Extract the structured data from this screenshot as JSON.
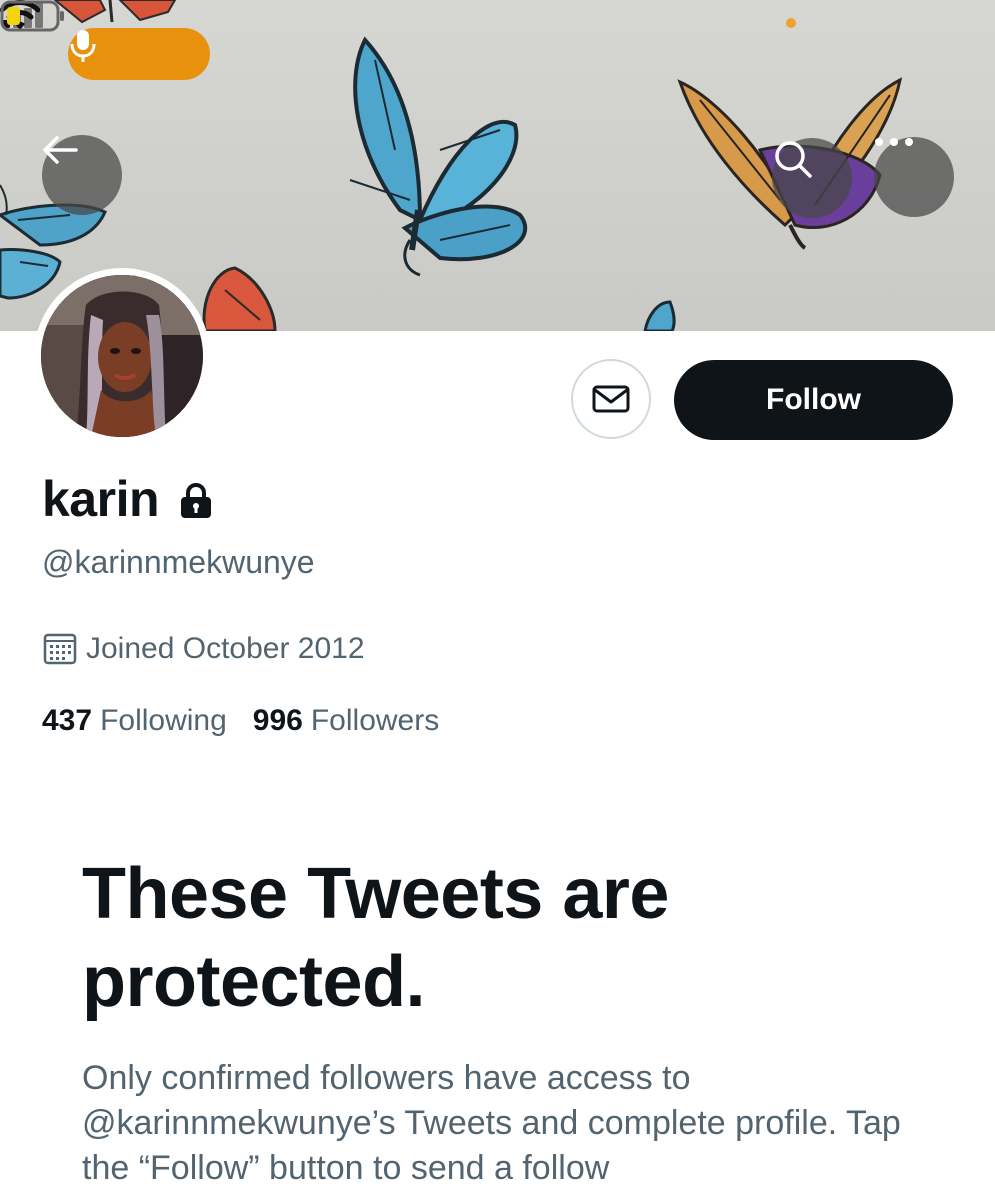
{
  "status_bar": {
    "mic_icon": "microphone-icon",
    "signal_icon": "cellular-signal-icon",
    "wifi_icon": "wifi-icon",
    "battery_icon": "battery-low-icon",
    "mic_pill_color": "#e8910f"
  },
  "nav": {
    "back_icon": "back-arrow-icon",
    "search_icon": "search-icon",
    "more_icon": "more-dots-icon"
  },
  "profile": {
    "display_name": "karin",
    "handle": "@karinnmekwunye",
    "joined": "Joined October 2012",
    "following_count": "437",
    "following_label": "Following",
    "followers_count": "996",
    "followers_label": "Followers",
    "protected_icon": "lock-icon"
  },
  "actions": {
    "message_icon": "envelope-icon",
    "follow_label": "Follow"
  },
  "protected_notice": {
    "title": "These Tweets are protected.",
    "body": "Only confirmed followers have access to @karinnmekwunye’s Tweets and complete profile. Tap the “Follow” button to send a follow"
  },
  "colors": {
    "text_primary": "#0f1419",
    "text_secondary": "#536471",
    "follow_button_bg": "#0f1419",
    "border": "#cfd9de"
  }
}
